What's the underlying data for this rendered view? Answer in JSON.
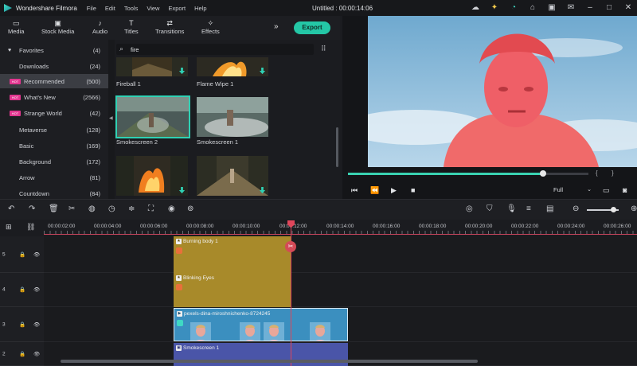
{
  "app": {
    "name": "Wondershare Filmora",
    "menu": [
      "File",
      "Edit",
      "Tools",
      "View",
      "Export",
      "Help"
    ],
    "document_title": "Untitled : 00:00:14:06"
  },
  "top_icons": [
    "sun-icon",
    "lightbulb-icon",
    "headset-icon",
    "bell-icon",
    "save-icon",
    "mail-icon",
    "minimize-icon",
    "maximize-icon",
    "close-icon"
  ],
  "library_tabs": [
    {
      "label": "Media",
      "icon": "folder-icon"
    },
    {
      "label": "Stock Media",
      "icon": "camera-icon"
    },
    {
      "label": "Audio",
      "icon": "music-note-icon"
    },
    {
      "label": "Titles",
      "icon": "text-icon"
    },
    {
      "label": "Transitions",
      "icon": "transition-icon"
    },
    {
      "label": "Effects",
      "icon": "sparkle-icon"
    }
  ],
  "export_label": "Export",
  "sidebar": {
    "items": [
      {
        "label": "Favorites",
        "count": "(4)",
        "marker": "heart"
      },
      {
        "label": "Downloads",
        "count": "(24)",
        "marker": "none"
      },
      {
        "label": "Recommended",
        "count": "(500)",
        "marker": "hot"
      },
      {
        "label": "What's New",
        "count": "(2566)",
        "marker": "hot"
      },
      {
        "label": "Strange World",
        "count": "(42)",
        "marker": "hot"
      },
      {
        "label": "Metaverse",
        "count": "(128)",
        "marker": "none"
      },
      {
        "label": "Basic",
        "count": "(169)",
        "marker": "none"
      },
      {
        "label": "Background",
        "count": "(172)",
        "marker": "none"
      },
      {
        "label": "Arrow",
        "count": "(81)",
        "marker": "none"
      },
      {
        "label": "Countdown",
        "count": "(84)",
        "marker": "none"
      }
    ],
    "hot_badge": "HOT",
    "active_index": 2
  },
  "search": {
    "value": "fire",
    "placeholder": ""
  },
  "effects": [
    {
      "label": "Fireball 1"
    },
    {
      "label": "Flame Wipe 1"
    },
    {
      "label": "Smokescreen 2",
      "selected": true
    },
    {
      "label": "Smokescreen 1"
    },
    {
      "label": ""
    },
    {
      "label": ""
    }
  ],
  "preview": {
    "progress": 0.81,
    "quality": "Full",
    "brace_open": "{",
    "brace_close": "}"
  },
  "timeline": {
    "ruler_labels": [
      "00:00:02:00",
      "00:00:04:00",
      "00:00:06:00",
      "00:00:08:00",
      "00:00:10:00",
      "00:00:12:00",
      "00:00:14:00",
      "00:00:16:00",
      "00:00:18:00",
      "00:00:20:00",
      "00:00:22:00",
      "00:00:24:00",
      "00:00:26:00"
    ],
    "tracks": [
      "5",
      "4",
      "3",
      "2"
    ],
    "clips": [
      {
        "title": "Burning body 1",
        "type": "effect"
      },
      {
        "title": "Blinking Eyes",
        "type": "effect"
      },
      {
        "title": "pexels-dina-miroshnichenko-8724245",
        "type": "video"
      },
      {
        "title": "Smokescreen 1",
        "type": "effect"
      }
    ]
  },
  "colors": {
    "accent": "#24c7a6",
    "playhead": "#e0465b",
    "effect_clip": "#a88a2a",
    "video_clip": "#3b8fbf"
  }
}
